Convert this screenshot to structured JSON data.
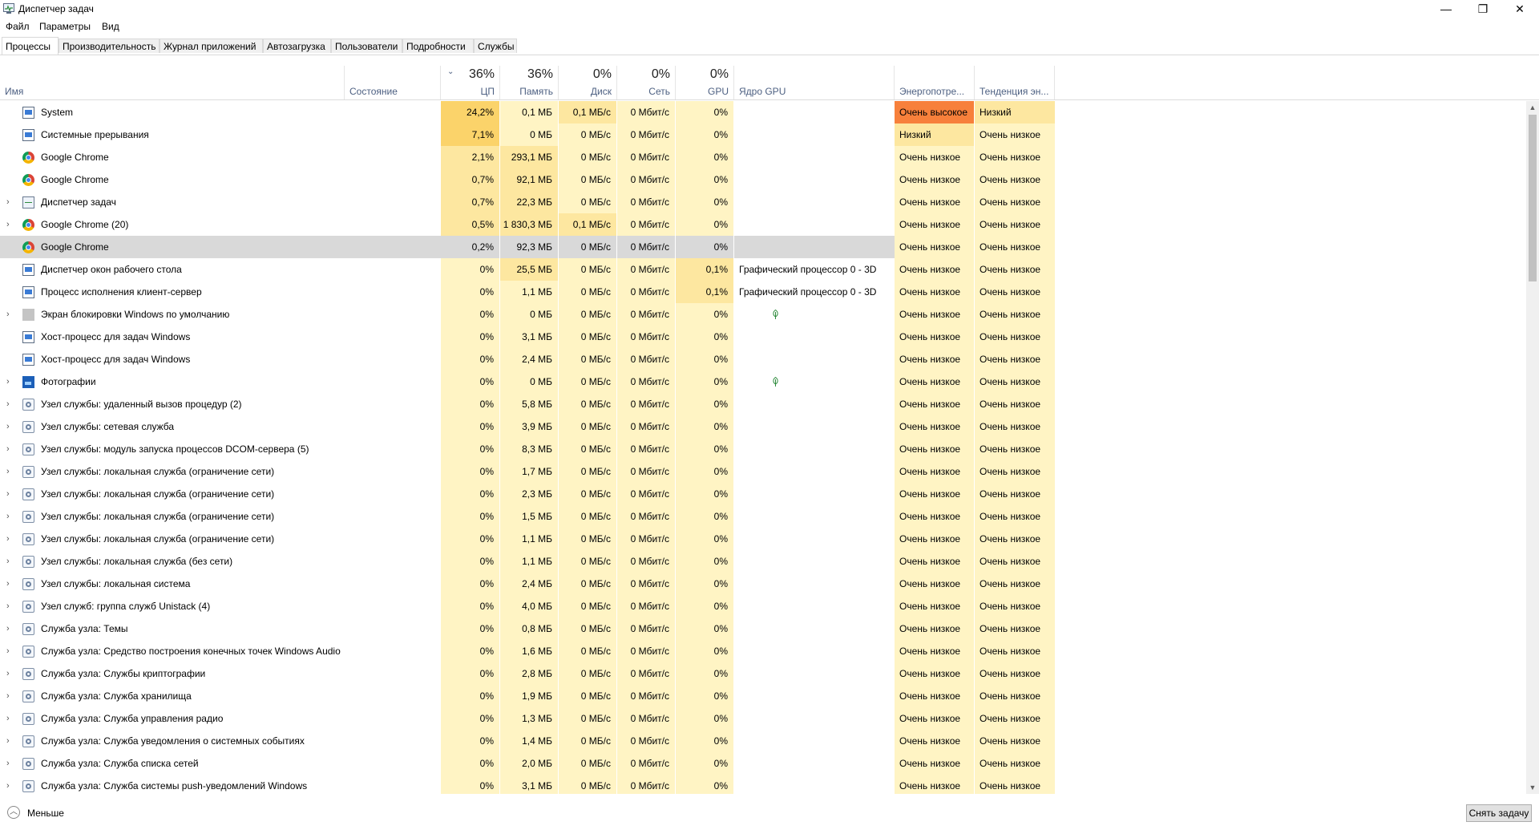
{
  "window": {
    "title": "Диспетчер задач",
    "controls": {
      "minimize": "—",
      "restore": "❐",
      "close": "✕"
    }
  },
  "menu": [
    "Файл",
    "Параметры",
    "Вид"
  ],
  "tabs": [
    "Процессы",
    "Производительность",
    "Журнал приложений",
    "Автозагрузка",
    "Пользователи",
    "Подробности",
    "Службы"
  ],
  "active_tab": "Процессы",
  "header": {
    "name": "Имя",
    "state": "Состояние",
    "cpu": {
      "pct": "36%",
      "label": "ЦП"
    },
    "mem": {
      "pct": "36%",
      "label": "Память"
    },
    "disk": {
      "pct": "0%",
      "label": "Диск"
    },
    "net": {
      "pct": "0%",
      "label": "Сеть"
    },
    "gpu": {
      "pct": "0%",
      "label": "GPU"
    },
    "gpu_engine": "Ядро GPU",
    "power": "Энергопотре...",
    "power_trend": "Тенденция эн..."
  },
  "colors": {
    "cpu_high": "#fbd36a",
    "cpu_mid": "#fde7a0",
    "cell_light": "#fff4c4",
    "mem_high": "#fde7a0",
    "power_very_high": "#f7803b",
    "power_low": "#fde7a0"
  },
  "rows": [
    {
      "icon": "system-icon",
      "name": "System",
      "expand": false,
      "leaf": false,
      "cpu": "24,2%",
      "mem": "0,1 МБ",
      "disk": "0,1 МБ/с",
      "net": "0 Мбит/с",
      "gpu": "0%",
      "gpu_engine": "",
      "power": "Очень высокое",
      "trend": "Низкий"
    },
    {
      "icon": "system-icon",
      "name": "Системные прерывания",
      "expand": false,
      "leaf": false,
      "cpu": "7,1%",
      "mem": "0 МБ",
      "disk": "0 МБ/с",
      "net": "0 Мбит/с",
      "gpu": "0%",
      "gpu_engine": "",
      "power": "Низкий",
      "trend": "Очень низкое"
    },
    {
      "icon": "chrome-icon",
      "name": "Google Chrome",
      "expand": false,
      "leaf": false,
      "cpu": "2,1%",
      "mem": "293,1 МБ",
      "disk": "0 МБ/с",
      "net": "0 Мбит/с",
      "gpu": "0%",
      "gpu_engine": "",
      "power": "Очень низкое",
      "trend": "Очень низкое"
    },
    {
      "icon": "chrome-icon",
      "name": "Google Chrome",
      "expand": false,
      "leaf": false,
      "cpu": "0,7%",
      "mem": "92,1 МБ",
      "disk": "0 МБ/с",
      "net": "0 Мбит/с",
      "gpu": "0%",
      "gpu_engine": "",
      "power": "Очень низкое",
      "trend": "Очень низкое"
    },
    {
      "icon": "task-manager-icon",
      "name": "Диспетчер задач",
      "expand": true,
      "leaf": false,
      "cpu": "0,7%",
      "mem": "22,3 МБ",
      "disk": "0 МБ/с",
      "net": "0 Мбит/с",
      "gpu": "0%",
      "gpu_engine": "",
      "power": "Очень низкое",
      "trend": "Очень низкое"
    },
    {
      "icon": "chrome-icon",
      "name": "Google Chrome (20)",
      "expand": true,
      "leaf": false,
      "cpu": "0,5%",
      "mem": "1 830,3 МБ",
      "disk": "0,1 МБ/с",
      "net": "0 Мбит/с",
      "gpu": "0%",
      "gpu_engine": "",
      "power": "Очень низкое",
      "trend": "Очень низкое"
    },
    {
      "icon": "chrome-icon",
      "name": "Google Chrome",
      "expand": false,
      "leaf": false,
      "selected": true,
      "cpu": "0,2%",
      "mem": "92,3 МБ",
      "disk": "0 МБ/с",
      "net": "0 Мбит/с",
      "gpu": "0%",
      "gpu_engine": "",
      "power": "Очень низкое",
      "trend": "Очень низкое"
    },
    {
      "icon": "system-icon",
      "name": "Диспетчер окон рабочего стола",
      "expand": false,
      "leaf": false,
      "cpu": "0%",
      "mem": "25,5 МБ",
      "disk": "0 МБ/с",
      "net": "0 Мбит/с",
      "gpu": "0,1%",
      "gpu_engine": "Графический процессор 0 - 3D",
      "power": "Очень низкое",
      "trend": "Очень низкое"
    },
    {
      "icon": "system-icon",
      "name": "Процесс исполнения клиент-сервер",
      "expand": false,
      "leaf": false,
      "cpu": "0%",
      "mem": "1,1 МБ",
      "disk": "0 МБ/с",
      "net": "0 Мбит/с",
      "gpu": "0,1%",
      "gpu_engine": "Графический процессор 0 - 3D",
      "power": "Очень низкое",
      "trend": "Очень низкое"
    },
    {
      "icon": "lock-screen-icon",
      "name": "Экран блокировки Windows по умолчанию",
      "expand": true,
      "leaf": true,
      "cpu": "0%",
      "mem": "0 МБ",
      "disk": "0 МБ/с",
      "net": "0 Мбит/с",
      "gpu": "0%",
      "gpu_engine": "",
      "power": "Очень низкое",
      "trend": "Очень низкое"
    },
    {
      "icon": "system-icon",
      "name": "Хост-процесс для задач Windows",
      "expand": false,
      "leaf": false,
      "cpu": "0%",
      "mem": "3,1 МБ",
      "disk": "0 МБ/с",
      "net": "0 Мбит/с",
      "gpu": "0%",
      "gpu_engine": "",
      "power": "Очень низкое",
      "trend": "Очень низкое"
    },
    {
      "icon": "system-icon",
      "name": "Хост-процесс для задач Windows",
      "expand": false,
      "leaf": false,
      "cpu": "0%",
      "mem": "2,4 МБ",
      "disk": "0 МБ/с",
      "net": "0 Мбит/с",
      "gpu": "0%",
      "gpu_engine": "",
      "power": "Очень низкое",
      "trend": "Очень низкое"
    },
    {
      "icon": "photos-icon",
      "name": "Фотографии",
      "expand": true,
      "leaf": true,
      "cpu": "0%",
      "mem": "0 МБ",
      "disk": "0 МБ/с",
      "net": "0 Мбит/с",
      "gpu": "0%",
      "gpu_engine": "",
      "power": "Очень низкое",
      "trend": "Очень низкое"
    },
    {
      "icon": "service-gear-icon",
      "name": "Узел службы: удаленный вызов процедур (2)",
      "expand": true,
      "leaf": false,
      "cpu": "0%",
      "mem": "5,8 МБ",
      "disk": "0 МБ/с",
      "net": "0 Мбит/с",
      "gpu": "0%",
      "gpu_engine": "",
      "power": "Очень низкое",
      "trend": "Очень низкое"
    },
    {
      "icon": "service-gear-icon",
      "name": "Узел службы: сетевая служба",
      "expand": true,
      "leaf": false,
      "cpu": "0%",
      "mem": "3,9 МБ",
      "disk": "0 МБ/с",
      "net": "0 Мбит/с",
      "gpu": "0%",
      "gpu_engine": "",
      "power": "Очень низкое",
      "trend": "Очень низкое"
    },
    {
      "icon": "service-gear-icon",
      "name": "Узел службы: модуль запуска процессов DCOM-сервера (5)",
      "expand": true,
      "leaf": false,
      "cpu": "0%",
      "mem": "8,3 МБ",
      "disk": "0 МБ/с",
      "net": "0 Мбит/с",
      "gpu": "0%",
      "gpu_engine": "",
      "power": "Очень низкое",
      "trend": "Очень низкое"
    },
    {
      "icon": "service-gear-icon",
      "name": "Узел службы: локальная служба (ограничение сети)",
      "expand": true,
      "leaf": false,
      "cpu": "0%",
      "mem": "1,7 МБ",
      "disk": "0 МБ/с",
      "net": "0 Мбит/с",
      "gpu": "0%",
      "gpu_engine": "",
      "power": "Очень низкое",
      "trend": "Очень низкое"
    },
    {
      "icon": "service-gear-icon",
      "name": "Узел службы: локальная служба (ограничение сети)",
      "expand": true,
      "leaf": false,
      "cpu": "0%",
      "mem": "2,3 МБ",
      "disk": "0 МБ/с",
      "net": "0 Мбит/с",
      "gpu": "0%",
      "gpu_engine": "",
      "power": "Очень низкое",
      "trend": "Очень низкое"
    },
    {
      "icon": "service-gear-icon",
      "name": "Узел службы: локальная служба (ограничение сети)",
      "expand": true,
      "leaf": false,
      "cpu": "0%",
      "mem": "1,5 МБ",
      "disk": "0 МБ/с",
      "net": "0 Мбит/с",
      "gpu": "0%",
      "gpu_engine": "",
      "power": "Очень низкое",
      "trend": "Очень низкое"
    },
    {
      "icon": "service-gear-icon",
      "name": "Узел службы: локальная служба (ограничение сети)",
      "expand": true,
      "leaf": false,
      "cpu": "0%",
      "mem": "1,1 МБ",
      "disk": "0 МБ/с",
      "net": "0 Мбит/с",
      "gpu": "0%",
      "gpu_engine": "",
      "power": "Очень низкое",
      "trend": "Очень низкое"
    },
    {
      "icon": "service-gear-icon",
      "name": "Узел службы: локальная служба (без сети)",
      "expand": true,
      "leaf": false,
      "cpu": "0%",
      "mem": "1,1 МБ",
      "disk": "0 МБ/с",
      "net": "0 Мбит/с",
      "gpu": "0%",
      "gpu_engine": "",
      "power": "Очень низкое",
      "trend": "Очень низкое"
    },
    {
      "icon": "service-gear-icon",
      "name": "Узел службы: локальная система",
      "expand": true,
      "leaf": false,
      "cpu": "0%",
      "mem": "2,4 МБ",
      "disk": "0 МБ/с",
      "net": "0 Мбит/с",
      "gpu": "0%",
      "gpu_engine": "",
      "power": "Очень низкое",
      "trend": "Очень низкое"
    },
    {
      "icon": "service-gear-icon",
      "name": "Узел служб: группа служб Unistack (4)",
      "expand": true,
      "leaf": false,
      "cpu": "0%",
      "mem": "4,0 МБ",
      "disk": "0 МБ/с",
      "net": "0 Мбит/с",
      "gpu": "0%",
      "gpu_engine": "",
      "power": "Очень низкое",
      "trend": "Очень низкое"
    },
    {
      "icon": "service-gear-icon",
      "name": "Служба узла: Темы",
      "expand": true,
      "leaf": false,
      "cpu": "0%",
      "mem": "0,8 МБ",
      "disk": "0 МБ/с",
      "net": "0 Мбит/с",
      "gpu": "0%",
      "gpu_engine": "",
      "power": "Очень низкое",
      "trend": "Очень низкое"
    },
    {
      "icon": "service-gear-icon",
      "name": "Служба узла: Средство построения конечных точек Windows Audio",
      "expand": true,
      "leaf": false,
      "cpu": "0%",
      "mem": "1,6 МБ",
      "disk": "0 МБ/с",
      "net": "0 Мбит/с",
      "gpu": "0%",
      "gpu_engine": "",
      "power": "Очень низкое",
      "trend": "Очень низкое"
    },
    {
      "icon": "service-gear-icon",
      "name": "Служба узла: Службы криптографии",
      "expand": true,
      "leaf": false,
      "cpu": "0%",
      "mem": "2,8 МБ",
      "disk": "0 МБ/с",
      "net": "0 Мбит/с",
      "gpu": "0%",
      "gpu_engine": "",
      "power": "Очень низкое",
      "trend": "Очень низкое"
    },
    {
      "icon": "service-gear-icon",
      "name": "Служба узла: Служба хранилища",
      "expand": true,
      "leaf": false,
      "cpu": "0%",
      "mem": "1,9 МБ",
      "disk": "0 МБ/с",
      "net": "0 Мбит/с",
      "gpu": "0%",
      "gpu_engine": "",
      "power": "Очень низкое",
      "trend": "Очень низкое"
    },
    {
      "icon": "service-gear-icon",
      "name": "Служба узла: Служба управления радио",
      "expand": true,
      "leaf": false,
      "cpu": "0%",
      "mem": "1,3 МБ",
      "disk": "0 МБ/с",
      "net": "0 Мбит/с",
      "gpu": "0%",
      "gpu_engine": "",
      "power": "Очень низкое",
      "trend": "Очень низкое"
    },
    {
      "icon": "service-gear-icon",
      "name": "Служба узла: Служба уведомления о системных событиях",
      "expand": true,
      "leaf": false,
      "cpu": "0%",
      "mem": "1,4 МБ",
      "disk": "0 МБ/с",
      "net": "0 Мбит/с",
      "gpu": "0%",
      "gpu_engine": "",
      "power": "Очень низкое",
      "trend": "Очень низкое"
    },
    {
      "icon": "service-gear-icon",
      "name": "Служба узла: Служба списка сетей",
      "expand": true,
      "leaf": false,
      "cpu": "0%",
      "mem": "2,0 МБ",
      "disk": "0 МБ/с",
      "net": "0 Мбит/с",
      "gpu": "0%",
      "gpu_engine": "",
      "power": "Очень низкое",
      "trend": "Очень низкое"
    },
    {
      "icon": "service-gear-icon",
      "name": "Служба узла: Служба системы push-уведомлений Windows",
      "expand": true,
      "leaf": false,
      "cpu": "0%",
      "mem": "3,1 МБ",
      "disk": "0 МБ/с",
      "net": "0 Мбит/с",
      "gpu": "0%",
      "gpu_engine": "",
      "power": "Очень низкое",
      "trend": "Очень низкое"
    }
  ],
  "footer": {
    "fewer_label": "Меньше",
    "end_task_label": "Снять задачу"
  }
}
